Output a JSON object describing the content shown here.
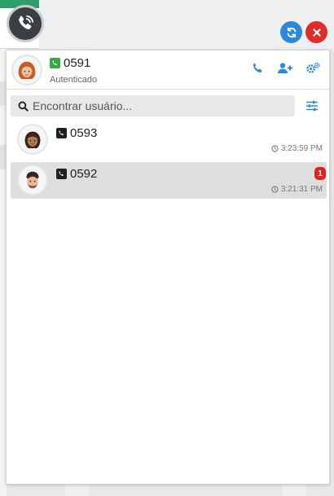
{
  "colors": {
    "accent": "#2c88d9",
    "danger": "#e02b2b",
    "online": "#3aa845",
    "selected_row": "#dedede"
  },
  "toolbar": {
    "logo_icon": "phone-logo-icon",
    "refresh_icon": "refresh-icon",
    "close_icon": "close-icon"
  },
  "current_user": {
    "extension": "0591",
    "status": "Autenticado",
    "phone_icon": "phone-green-icon",
    "actions": [
      "phone-icon",
      "add-user-icon",
      "settings-icon"
    ]
  },
  "search": {
    "placeholder": "Encontrar usuário...",
    "value": "",
    "filter_icon": "sliders-icon"
  },
  "contacts": [
    {
      "extension": "0593",
      "time": "3:23:59 PM",
      "unread": "",
      "selected": false
    },
    {
      "extension": "0592",
      "time": "3:21:31 PM",
      "unread": "1",
      "selected": true
    }
  ]
}
